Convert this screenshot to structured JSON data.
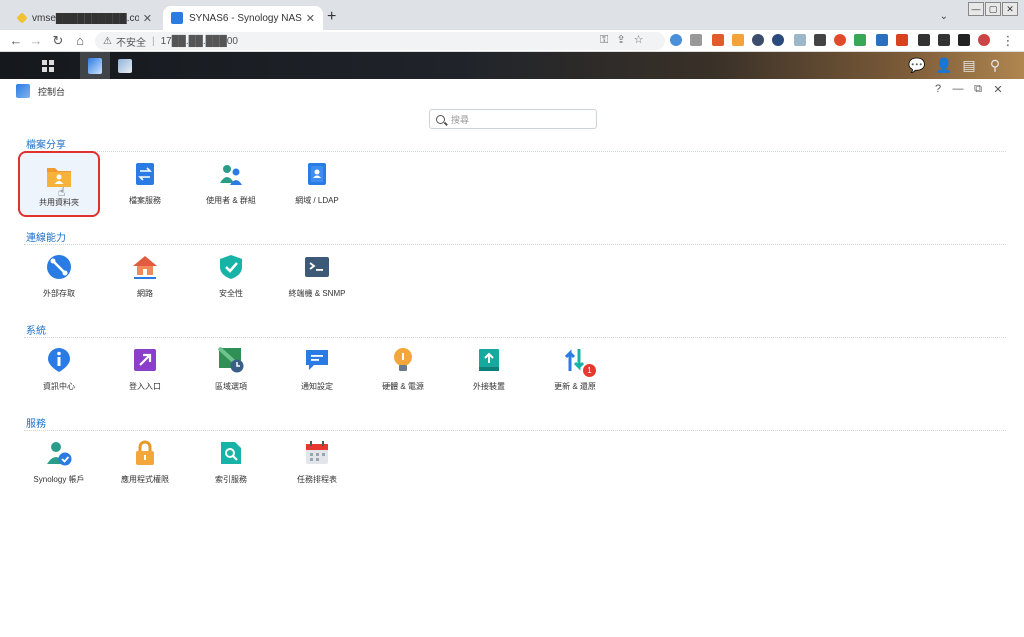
{
  "browser": {
    "tabs": [
      {
        "title": "vmse██████████.com.tw - VM",
        "close": "✕"
      },
      {
        "title": "SYNAS6 - Synology NAS",
        "close": "✕"
      }
    ],
    "new_tab": "+",
    "tab_menu": "⌄",
    "security_label": "不安全",
    "url": "17██.██.███00",
    "window_controls": [
      "—",
      "▢",
      "✕"
    ]
  },
  "dsm": {
    "window_title": "控制台",
    "window_controls": [
      "?",
      "—",
      "⧉",
      "✕"
    ],
    "search_placeholder": "搜尋"
  },
  "sections": [
    {
      "title": "檔案分享",
      "items": [
        {
          "label": "共用資料夾",
          "icon": "shared-folder-icon",
          "selected": true
        },
        {
          "label": "檔案服務",
          "icon": "file-services-icon"
        },
        {
          "label": "使用者 & 群組",
          "icon": "user-group-icon"
        },
        {
          "label": "網域 / LDAP",
          "icon": "domain-ldap-icon"
        }
      ]
    },
    {
      "title": "連線能力",
      "items": [
        {
          "label": "外部存取",
          "icon": "external-access-icon"
        },
        {
          "label": "網路",
          "icon": "network-icon"
        },
        {
          "label": "安全性",
          "icon": "security-icon"
        },
        {
          "label": "終端機 & SNMP",
          "icon": "terminal-icon"
        }
      ]
    },
    {
      "title": "系統",
      "items": [
        {
          "label": "資訊中心",
          "icon": "info-center-icon"
        },
        {
          "label": "登入入口",
          "icon": "login-portal-icon"
        },
        {
          "label": "區域選項",
          "icon": "regional-options-icon"
        },
        {
          "label": "通知設定",
          "icon": "notification-icon"
        },
        {
          "label": "硬體 & 電源",
          "icon": "hardware-power-icon"
        },
        {
          "label": "外接裝置",
          "icon": "external-devices-icon"
        },
        {
          "label": "更新 & 還原",
          "icon": "update-restore-icon",
          "badge": "1"
        }
      ]
    },
    {
      "title": "服務",
      "items": [
        {
          "label": "Synology 帳戶",
          "icon": "synology-account-icon"
        },
        {
          "label": "應用程式權限",
          "icon": "app-privileges-icon"
        },
        {
          "label": "索引服務",
          "icon": "indexing-service-icon"
        },
        {
          "label": "任務排程表",
          "icon": "task-scheduler-icon"
        }
      ]
    }
  ],
  "colors": {
    "section_title": "#1a6fc8",
    "selected_border": "#e0312e"
  }
}
